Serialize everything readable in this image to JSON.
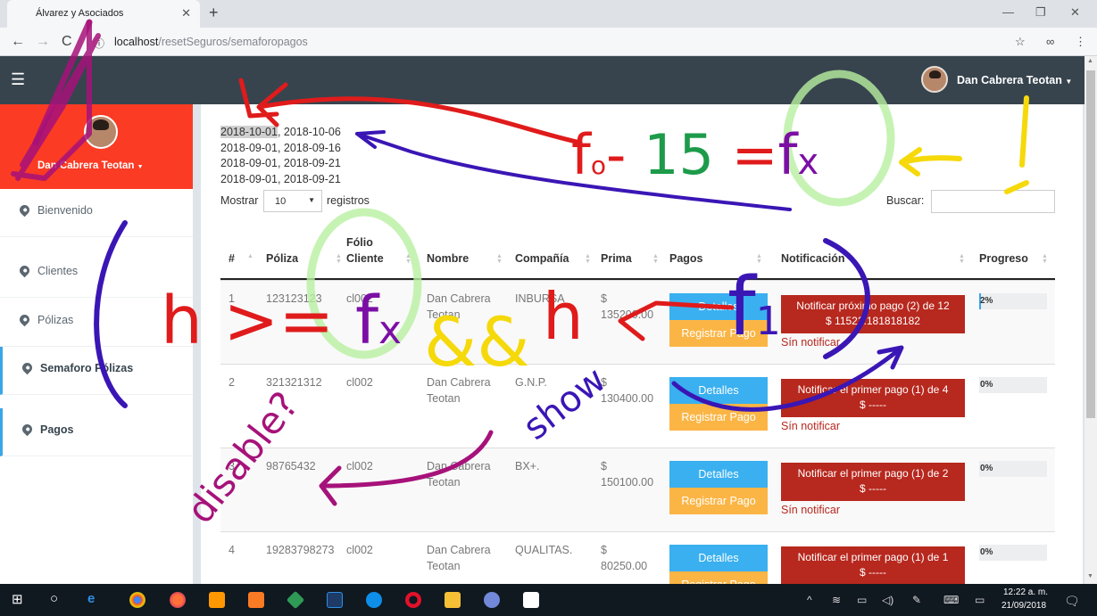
{
  "browser": {
    "tab_title": "Álvarez y Asociados",
    "url_host": "localhost",
    "url_path": "/resetSeguros/semaforopagos",
    "icons": [
      "back-icon",
      "forward-icon",
      "reload-icon",
      "info-icon",
      "star-icon",
      "incognito-icon",
      "more-icon"
    ]
  },
  "navbar": {
    "user_name": "Dan Cabrera Teotan",
    "icons": [
      "hamburger-icon",
      "avatar"
    ]
  },
  "sidebar": {
    "profile_name": "Dan Cabrera Teotan",
    "items": [
      {
        "label": "Bienvenido",
        "active": false
      },
      {
        "label": "Clientes",
        "active": false
      },
      {
        "label": "Pólizas",
        "active": false
      },
      {
        "label": "Semaforo Pólizas",
        "active": true
      },
      {
        "label": "Pagos",
        "active": true
      }
    ]
  },
  "main": {
    "dates": {
      "line1_highlight": "2018-10-01",
      "line1_rest": ", 2018-10-06",
      "line2": "2018-09-01, 2018-09-16",
      "line3": "2018-09-01, 2018-09-21",
      "line4": "2018-09-01, 2018-09-21"
    },
    "show_label": "Mostrar",
    "show_value": "10",
    "show_label2": "registros",
    "search_label": "Buscar:",
    "search_value": "",
    "columns": [
      "#",
      "Póliza",
      "Fólio",
      "Cliente",
      "Nombre",
      "Compañía",
      "Prima",
      "Pagos",
      "Notificación",
      "Progreso"
    ],
    "rows": [
      {
        "num": "1",
        "poliza": "123123123",
        "folio": "cl002",
        "nombre1": "Dan Cabrera",
        "nombre2": "Teotan",
        "compania": "INBURSA",
        "prima1": "$",
        "prima2": "135200.00",
        "btn_detalles": "Detalles",
        "btn_registrar": "Registrar Pago",
        "notif1": "Notificar próximo pago (2) de 12",
        "notif2": "$ 11522.181818182",
        "notif_status": "Sín notificar",
        "progress_label": "2%",
        "progress_value": 2
      },
      {
        "num": "2",
        "poliza": "321321312",
        "folio": "cl002",
        "nombre1": "Dan Cabrera",
        "nombre2": "Teotan",
        "compania": "G.N.P.",
        "prima1": "$",
        "prima2": "130400.00",
        "btn_detalles": "Detalles",
        "btn_registrar": "Registrar Pago",
        "notif1": "Notificar el primer pago (1) de 4",
        "notif2": "$ -----",
        "notif_status": "Sín notificar",
        "progress_label": "0%",
        "progress_value": 0
      },
      {
        "num": "3",
        "poliza": "98765432",
        "folio": "cl002",
        "nombre1": "Dan Cabrera",
        "nombre2": "Teotan",
        "compania": "BX+.",
        "prima1": "$",
        "prima2": "150100.00",
        "btn_detalles": "Detalles",
        "btn_registrar": "Registrar Pago",
        "notif1": "Notificar el primer pago (1) de 2",
        "notif2": "$ -----",
        "notif_status": "Sín notificar",
        "progress_label": "0%",
        "progress_value": 0
      },
      {
        "num": "4",
        "poliza": "19283798273",
        "folio": "cl002",
        "nombre1": "Dan Cabrera",
        "nombre2": "Teotan",
        "compania": "QUALITAS.",
        "prima1": "$",
        "prima2": "80250.00",
        "btn_detalles": "Detalles",
        "btn_registrar": "Registrar Pago",
        "notif1": "Notificar el primer pago (1) de 1",
        "notif2": "$ -----",
        "notif_status": "",
        "progress_label": "0%",
        "progress_value": 0
      }
    ]
  },
  "annotations": {
    "f0_formula": "f₀ - 15 = fx",
    "exclamation": "!",
    "h_formula": "(h >= fx && h <= f1",
    "f1": "f1",
    "show": "show",
    "disable": "disable?",
    "colors": {
      "red": "#e01b1b",
      "purple": "#3a16b5",
      "magenta": "#a6127a",
      "yellow": "#f5d90a",
      "green": "#1d9b4a",
      "violet": "#7b0fa5",
      "halo": "#b8f0a0"
    }
  },
  "taskbar": {
    "time": "12:22 a. m.",
    "date": "21/09/2018",
    "icons": [
      "windows-icon",
      "search-icon",
      "edge-icon",
      "chrome-icon",
      "firefox-icon",
      "sublime-icon",
      "xampp-icon",
      "git-icon",
      "vscode-icon",
      "teamviewer-icon",
      "opera-icon",
      "explorer-icon",
      "discord-icon",
      "app-icon"
    ]
  }
}
